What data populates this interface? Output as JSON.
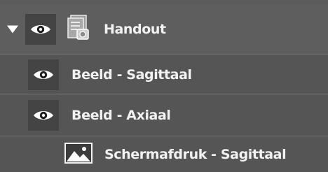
{
  "layers": {
    "group": {
      "label": "Handout",
      "expanded": true,
      "visible": true,
      "icon": "document-stack-icon"
    },
    "items": [
      {
        "label": "Beeld - Sagittaal",
        "visible": true,
        "icon": "eye-icon"
      },
      {
        "label": "Beeld - Axiaal",
        "visible": true,
        "icon": "eye-icon"
      },
      {
        "label": "Schermafdruk - Sagittaal",
        "visible": false,
        "icon": "image-icon"
      }
    ]
  },
  "colors": {
    "row_bg": "#5e5e5e",
    "child_bg": "#555555",
    "eye_box_bg": "#444444",
    "text": "#f2f2f2"
  }
}
